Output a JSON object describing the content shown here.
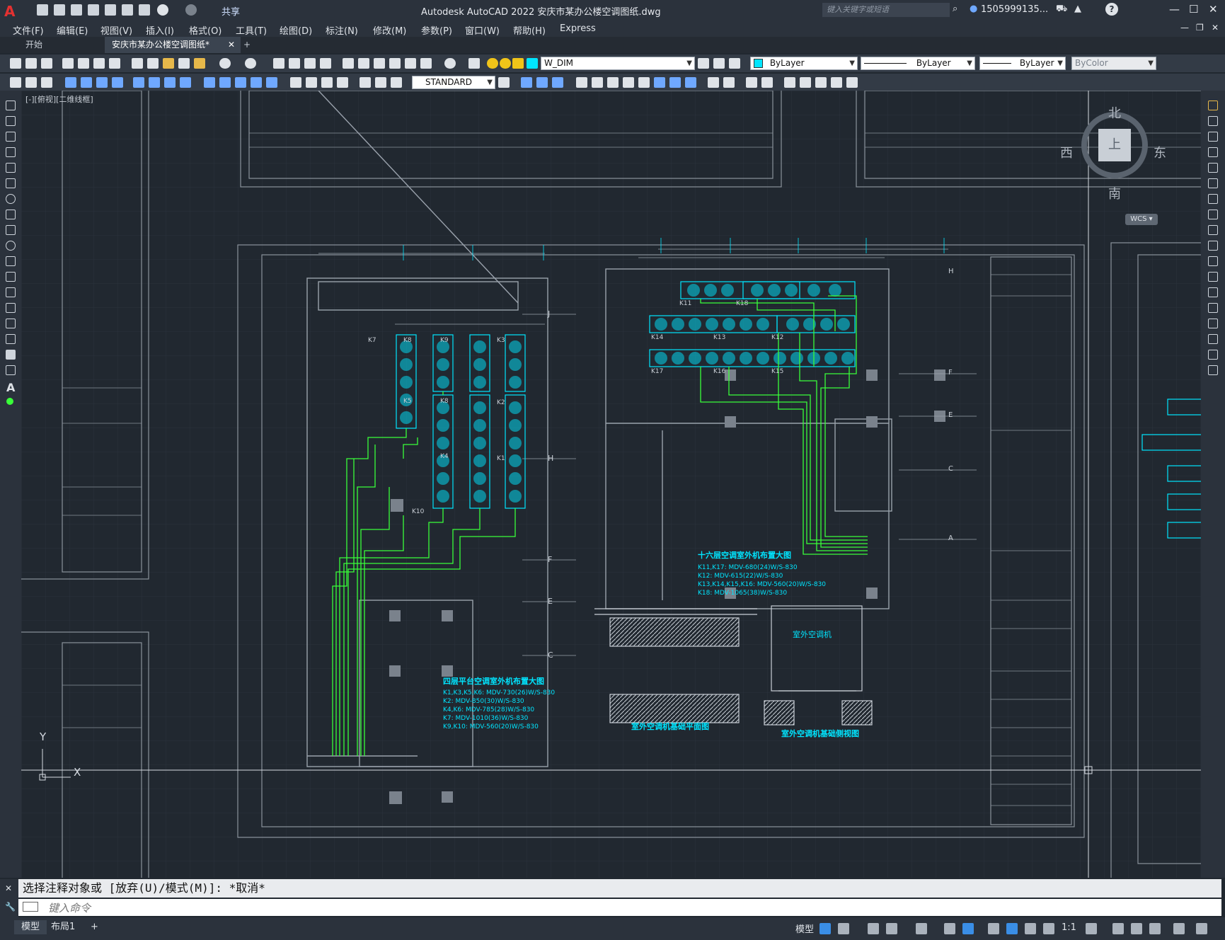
{
  "app": {
    "logo": "A",
    "title": "Autodesk AutoCAD 2022    安庆市某办公楼空调图纸.dwg",
    "share": "共享",
    "search_placeholder": "键入关键字或短语",
    "user": "1505999135...",
    "help": "?"
  },
  "menu": [
    "文件(F)",
    "编辑(E)",
    "视图(V)",
    "插入(I)",
    "格式(O)",
    "工具(T)",
    "绘图(D)",
    "标注(N)",
    "修改(M)",
    "参数(P)",
    "窗口(W)",
    "帮助(H)",
    "Express"
  ],
  "tabs": {
    "start": "开始",
    "drawing": "安庆市某办公楼空调图纸*",
    "close": "✕",
    "add": "+"
  },
  "toolbar": {
    "layer": "W_DIM",
    "color": "ByLayer",
    "linetype": "ByLayer",
    "lineweight": "ByLayer",
    "plotstyle": "ByColor",
    "textstyle": "STANDARD"
  },
  "viewport": {
    "label": "[-][俯视][二维线框]",
    "compass": {
      "n": "北",
      "s": "南",
      "e": "东",
      "w": "西",
      "top": "上"
    },
    "wcs": "WCS ▾",
    "ucs_x": "X",
    "ucs_y": "Y"
  },
  "drawing": {
    "plan4_title": "四层平台空调室外机布置大图",
    "plan4_notes": [
      "K1,K3,K5,K6: MDV-730(26)W/S-830",
      "K2: MDV-850(30)W/S-830",
      "K4,K6: MDV-785(28)W/S-830",
      "K7: MDV-1010(36)W/S-830",
      "K9,K10: MDV-560(20)W/S-830"
    ],
    "plan16_title": "十六层空调室外机布置大图",
    "plan16_notes": [
      "K11,K17: MDV-680(24)W/S-830",
      "K12: MDV-615(22)W/S-830",
      "K13,K14,K15,K16: MDV-560(20)W/S-830",
      "K18: MDV-1065(38)W/S-830"
    ],
    "base_plan_title": "室外空调机基础平面图",
    "base_side_title": "室外空调机基础侧视图",
    "outdoor_unit": "室外空调机",
    "unit_tags_left": [
      "K7",
      "K8",
      "K9",
      "K3",
      "K5",
      "K8",
      "K2",
      "K4",
      "K1",
      "K10"
    ],
    "unit_tags_right": [
      "K11",
      "K18",
      "K14",
      "K13",
      "K12",
      "K17",
      "K16",
      "K15"
    ],
    "grid_labels_left": [
      "J",
      "H",
      "F",
      "E",
      "C"
    ],
    "grid_labels_right": [
      "H",
      "F",
      "E",
      "C",
      "A"
    ]
  },
  "command": {
    "history": "选择注释对象或 [放弃(U)/模式(M)]: *取消*",
    "placeholder": "键入命令"
  },
  "status": {
    "model_tab": "模型",
    "layout_tab": "布局1",
    "add": "+",
    "model_space": "模型",
    "scale": "1:1"
  },
  "colors": {
    "accent_green": "#39ff39",
    "accent_cyan": "#00e5ff",
    "title_red": "#e33131"
  }
}
